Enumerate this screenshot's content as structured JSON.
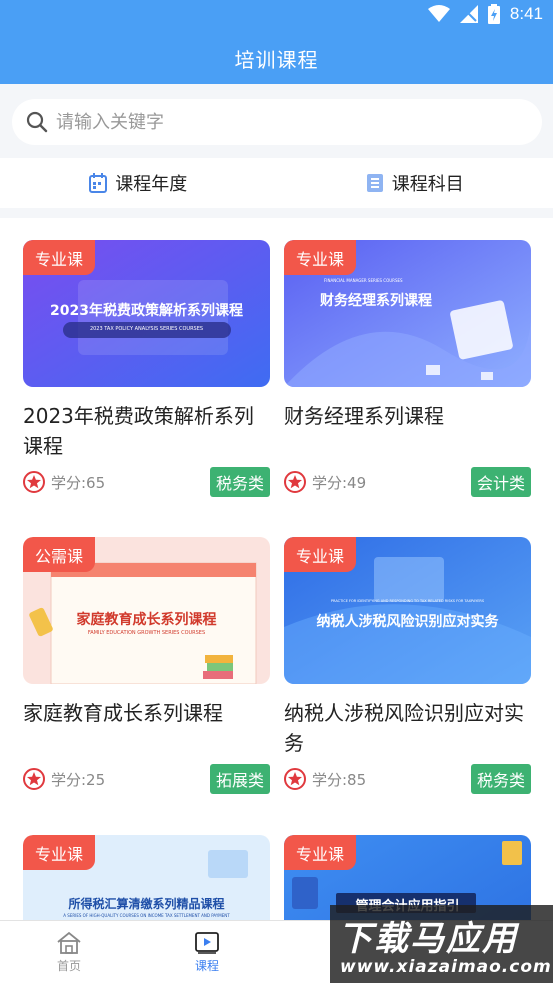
{
  "status": {
    "time": "8:41"
  },
  "header": {
    "title": "培训课程"
  },
  "search": {
    "placeholder": "请输入关键字"
  },
  "filters": [
    {
      "label": "课程年度",
      "icon": "calendar-icon"
    },
    {
      "label": "课程科目",
      "icon": "list-icon"
    }
  ],
  "courses": [
    {
      "tag": "专业课",
      "thumb_text": "2023年税费政策解析系列课程",
      "thumb_sub": "2023 TAX POLICY ANALYSIS SERIES COURSES",
      "title": "2023年税费政策解析系列课程",
      "credit": "学分:65",
      "category": "税务类",
      "theme": "#6b5cf0"
    },
    {
      "tag": "专业课",
      "thumb_text": "财务经理系列课程",
      "thumb_sub": "FINANCIAL MANAGER SERIES COURSES",
      "title": "财务经理系列课程",
      "credit": "学分:49",
      "category": "会计类",
      "theme": "#5b6ff5"
    },
    {
      "tag": "公需课",
      "thumb_text": "家庭教育成长系列课程",
      "thumb_sub": "FAMILY EDUCATION GROWTH SERIES COURSES",
      "title": "家庭教育成长系列课程",
      "credit": "学分:25",
      "category": "拓展类",
      "theme": "#fbe3de"
    },
    {
      "tag": "专业课",
      "thumb_text": "纳税人涉税风险识别应对实务",
      "thumb_sub": "PRACTICE FOR IDENTIFYING AND RESPONDING TO TAX RELATED RISKS FOR TAXPAYERS",
      "title": "纳税人涉税风险识别应对实务",
      "credit": "学分:85",
      "category": "税务类",
      "theme": "#3d7ff0"
    },
    {
      "tag": "专业课",
      "thumb_text": "所得税汇算清缴系列精品课程",
      "thumb_sub": "A SERIES OF HIGH-QUALITY COURSES ON INCOME TAX SETTLEMENT AND PAYMENT",
      "title": "",
      "credit": "",
      "category": "",
      "theme": "#dfeefc"
    },
    {
      "tag": "专业课",
      "thumb_text": "管理会计应用指引",
      "thumb_sub": "",
      "title": "",
      "credit": "",
      "category": "",
      "theme": "#3f8ef2"
    }
  ],
  "tabbar": [
    {
      "label": "首页",
      "icon": "home-icon"
    },
    {
      "label": "课程",
      "icon": "video-course-icon"
    }
  ],
  "watermark": {
    "main": "下载马应用",
    "url": "www.xiazaimao.com"
  },
  "colors": {
    "primary": "#4a9ff5",
    "tag_red": "#f2574a",
    "category_green": "#3db272",
    "tab_active": "#3b7ff0"
  }
}
